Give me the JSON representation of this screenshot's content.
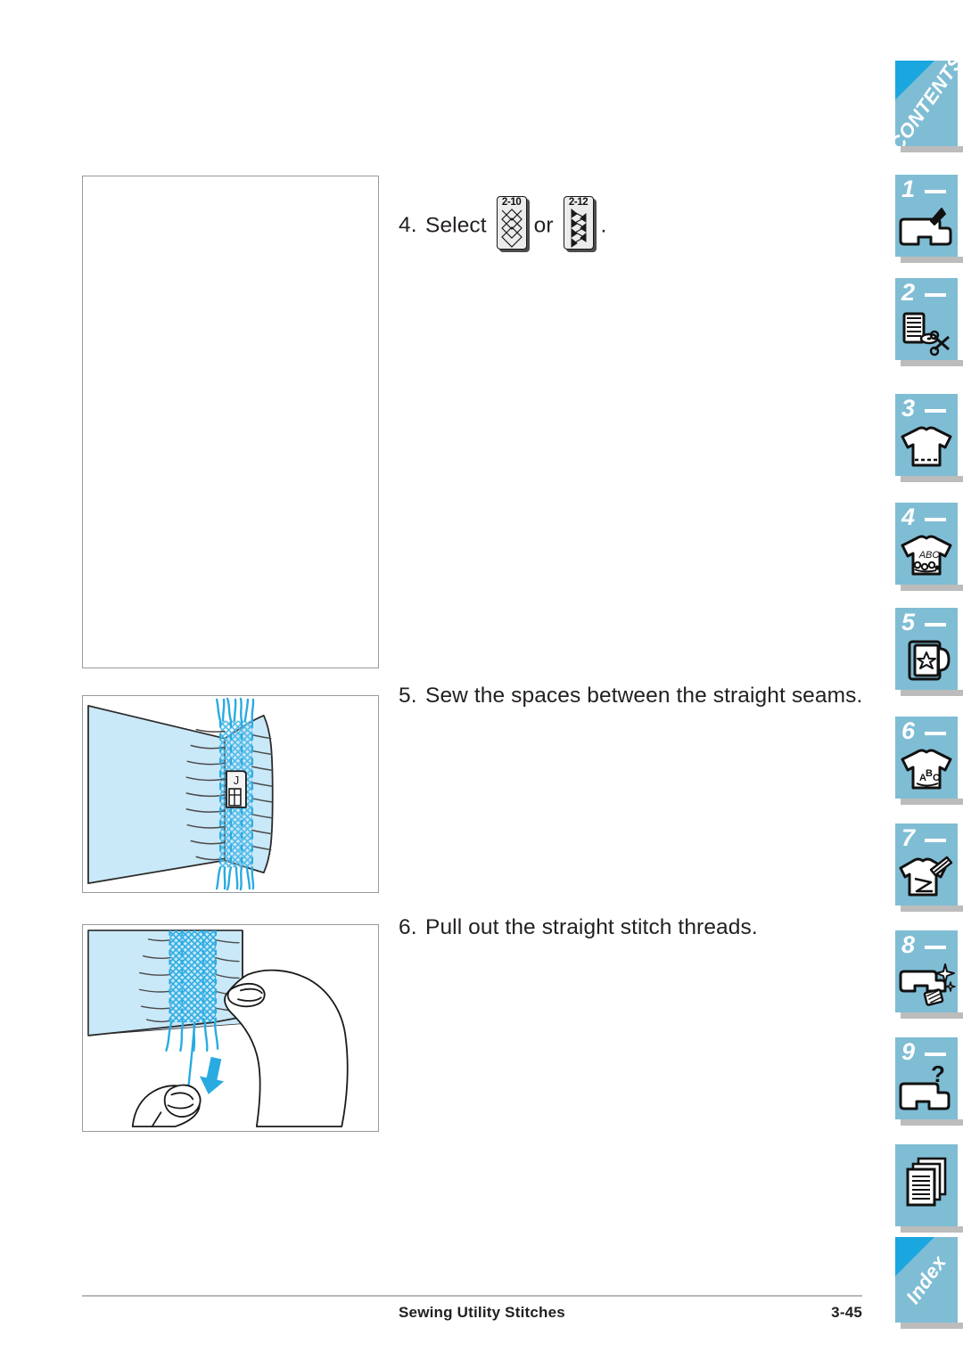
{
  "page": {
    "background": "#ffffff",
    "accent_blue": "#7fbdd4",
    "corner_blue": "#1aa7e0",
    "illustration_fill": "#bfe4f6",
    "illustration_line": "#29abe2"
  },
  "steps": [
    {
      "number": "4.",
      "text_before": "Select",
      "stitch_a": "2-10",
      "connector": "or",
      "stitch_b": "2-12",
      "text_after": "."
    },
    {
      "number": "5.",
      "text": "Sew the spaces between the straight seams."
    },
    {
      "number": "6.",
      "text": "Pull out the straight stitch threads."
    }
  ],
  "figures": {
    "blank": {
      "name": "blank-illustration-placeholder",
      "caption": ""
    },
    "smocking": {
      "name": "smocking-sew-spaces-illustration",
      "presser_foot_label": "J"
    },
    "pulling": {
      "name": "pull-out-threads-illustration",
      "caption": ""
    }
  },
  "footer": {
    "title": "Sewing Utility Stitches",
    "page_number": "3-45"
  },
  "tabs": [
    {
      "id": "contents",
      "label": "CONTENTS",
      "kind": "word",
      "icon": ""
    },
    {
      "id": "chapter-1",
      "label": "1",
      "kind": "number",
      "icon": "sewing-machine-icon"
    },
    {
      "id": "chapter-2",
      "label": "2",
      "kind": "number",
      "icon": "thread-spool-scissors-icon"
    },
    {
      "id": "chapter-3",
      "label": "3",
      "kind": "number",
      "icon": "shirt-stitched-hem-icon"
    },
    {
      "id": "chapter-4",
      "label": "4",
      "kind": "number",
      "icon": "shirt-abc-decorative-icon"
    },
    {
      "id": "chapter-5",
      "label": "5",
      "kind": "number",
      "icon": "embroidery-hoop-star-icon"
    },
    {
      "id": "chapter-6",
      "label": "6",
      "kind": "number",
      "icon": "shirt-abc-lettering-icon"
    },
    {
      "id": "chapter-7",
      "label": "7",
      "kind": "number",
      "icon": "shirt-edit-pencil-icon"
    },
    {
      "id": "chapter-8",
      "label": "8",
      "kind": "number",
      "icon": "machine-maintenance-icon"
    },
    {
      "id": "chapter-9",
      "label": "9",
      "kind": "number",
      "icon": "machine-question-icon"
    },
    {
      "id": "appendix",
      "label": "",
      "kind": "icon-only",
      "icon": "stacked-pages-icon"
    },
    {
      "id": "index",
      "label": "Index",
      "kind": "word",
      "icon": ""
    }
  ]
}
